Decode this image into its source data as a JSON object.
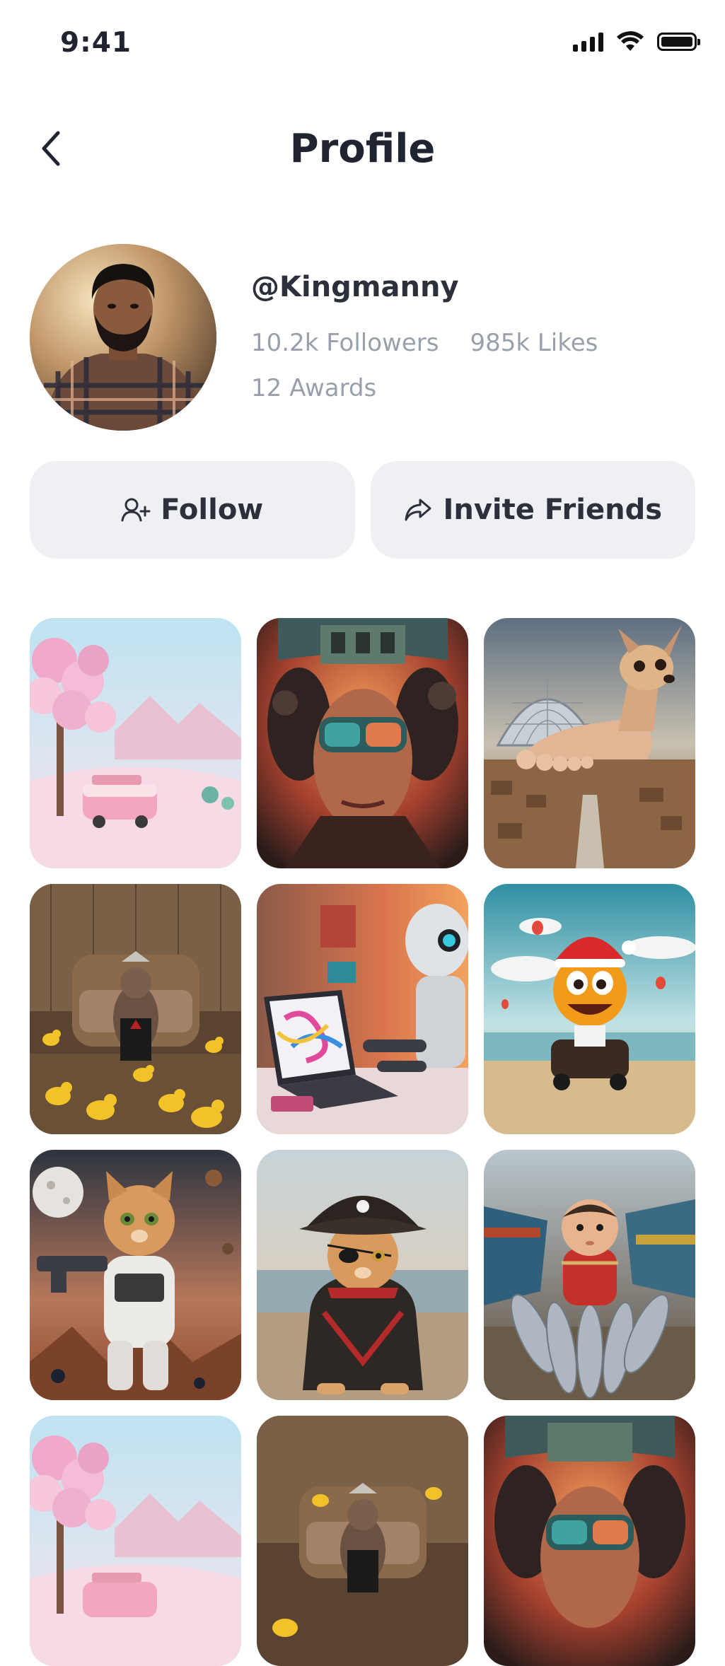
{
  "status_bar": {
    "time": "9:41",
    "icons": [
      "signal-icon",
      "wifi-icon",
      "battery-icon"
    ]
  },
  "header": {
    "title": "Profile",
    "back_icon": "chevron-left-icon"
  },
  "profile": {
    "username": "@Kingmanny",
    "followers": "10.2k Followers",
    "likes": "985k Likes",
    "awards": "12 Awards"
  },
  "actions": {
    "follow_label": "Follow",
    "follow_icon": "user-plus-icon",
    "invite_label": "Invite Friends",
    "invite_icon": "share-arrow-icon"
  },
  "gallery": [
    {
      "subject": "pink-van-candy-landscape"
    },
    {
      "subject": "woman-vr-goggles"
    },
    {
      "subject": "chihuahua-giant-foot"
    },
    {
      "subject": "squirrel-tuxedo-ducks"
    },
    {
      "subject": "robot-laptop"
    },
    {
      "subject": "smiley-santa-hat-car"
    },
    {
      "subject": "cat-astronaut-gun"
    },
    {
      "subject": "pirate-cat"
    },
    {
      "subject": "baby-fish-boats"
    },
    {
      "subject": "pink-van-candy-landscape"
    },
    {
      "subject": "squirrel-tuxedo-ducks"
    },
    {
      "subject": "woman-vr-goggles"
    }
  ],
  "colors": {
    "text_primary": "#1f2430",
    "text_secondary": "#9aa0ab",
    "button_bg": "#eef0f4"
  }
}
